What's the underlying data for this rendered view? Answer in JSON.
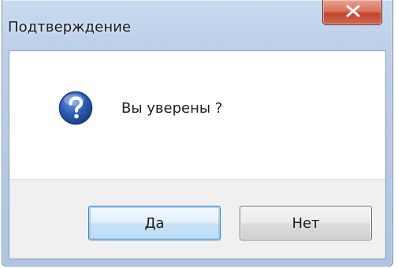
{
  "dialog": {
    "title": "Подтверждение",
    "message": "Вы уверены ?",
    "icon": "question-icon",
    "close_icon": "close-icon",
    "buttons": {
      "yes_label": "Да",
      "no_label": "Нет"
    }
  },
  "colors": {
    "title_bar": "#bcd0ea",
    "close_button": "#c4432b",
    "icon_blue": "#1c4fa3",
    "footer": "#f0f0f0",
    "default_button_border": "#3c7fb1"
  }
}
